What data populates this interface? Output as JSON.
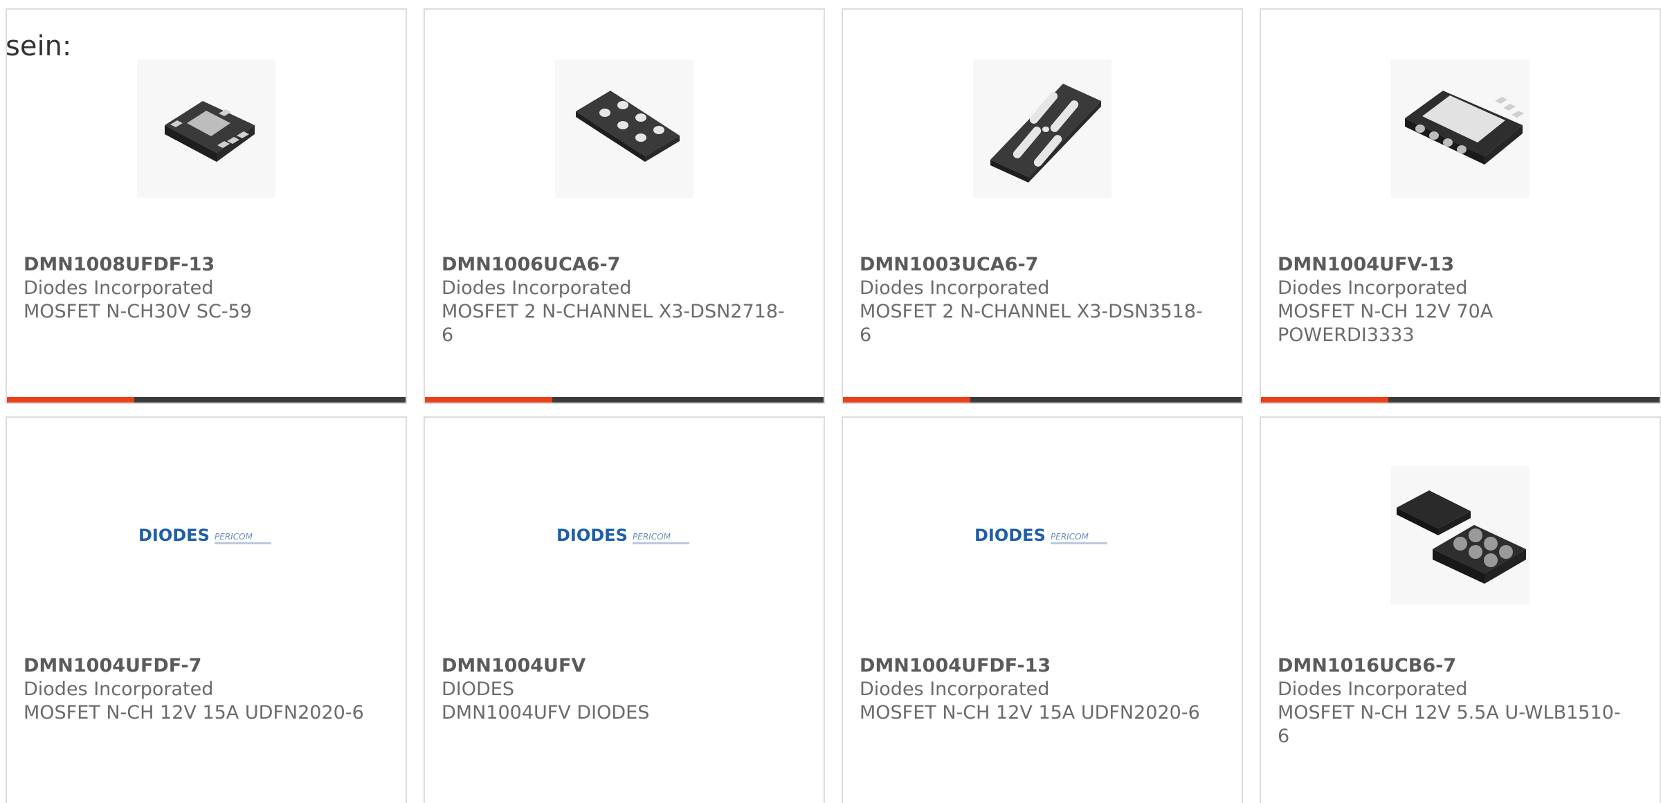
{
  "intro_text": "sein:",
  "colors": {
    "accent": "#e8411c",
    "bar_dark": "#3c3c3c",
    "border": "#dcdcdc",
    "text": "#6b6b6b",
    "diodes_blue": "#1f5fa8"
  },
  "cards": [
    {
      "part": "DMN1008UFDF-13",
      "manufacturer": "Diodes Incorporated",
      "description": "MOSFET N-CH30V SC-59",
      "image_icon": "chip-udfn-icon",
      "progress": 0.32
    },
    {
      "part": "DMN1006UCA6-7",
      "manufacturer": "Diodes Incorporated",
      "description": "MOSFET 2 N-CHANNEL X3-DSN2718-6",
      "image_icon": "chip-dsn-dots-icon",
      "progress": 0.32
    },
    {
      "part": "DMN1003UCA6-7",
      "manufacturer": "Diodes Incorporated",
      "description": "MOSFET 2 N-CHANNEL X3-DSN3518-6",
      "image_icon": "chip-dsn-bars-icon",
      "progress": 0.32
    },
    {
      "part": "DMN1004UFV-13",
      "manufacturer": "Diodes Incorporated",
      "description": "MOSFET N-CH 12V 70A POWERDI3333",
      "image_icon": "chip-powerdi-icon",
      "progress": 0.32
    },
    {
      "part": "DMN1004UFDF-7",
      "manufacturer": "Diodes Incorporated",
      "description": "MOSFET N-CH 12V 15A UDFN2020-6",
      "image_icon": "diodes-logo-icon",
      "logo_text": "DIODES",
      "logo_sub": "PERICOM"
    },
    {
      "part": "DMN1004UFV",
      "manufacturer": "DIODES",
      "description": "DMN1004UFV DIODES",
      "image_icon": "diodes-logo-icon",
      "logo_text": "DIODES",
      "logo_sub": "PERICOM"
    },
    {
      "part": "DMN1004UFDF-13",
      "manufacturer": "Diodes Incorporated",
      "description": "MOSFET N-CH 12V 15A UDFN2020-6",
      "image_icon": "diodes-logo-icon",
      "logo_text": "DIODES",
      "logo_sub": "PERICOM"
    },
    {
      "part": "DMN1016UCB6-7",
      "manufacturer": "Diodes Incorporated",
      "description": "MOSFET N-CH 12V 5.5A U-WLB1510-6",
      "image_icon": "chip-wlb-balls-icon"
    }
  ]
}
